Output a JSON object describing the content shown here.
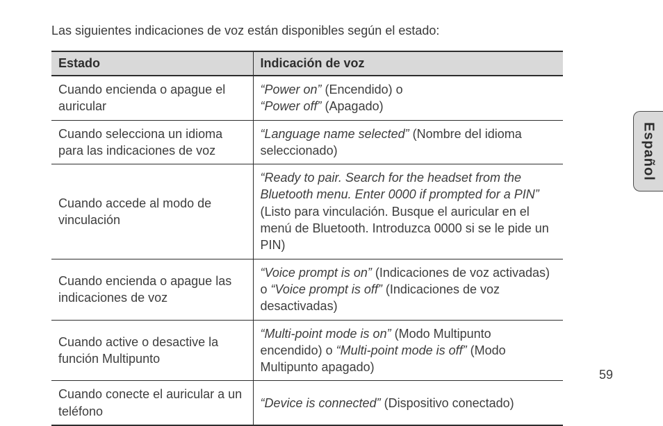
{
  "intro": "Las siguientes indicaciones de voz están disponibles según el estado:",
  "headers": {
    "status": "Estado",
    "voice": "Indicación de voz"
  },
  "rows": [
    {
      "status": "Cuando encienda o apague el auricular",
      "voice_html": "<span class=\"ital\">“Power on”</span> (Encendido) o <br><span class=\"ital\">“Power off”</span> (Apagado)"
    },
    {
      "status": "Cuando selecciona un idioma para las indicaciones de voz",
      "voice_html": "<span class=\"ital\">“Language name selected”</span> (Nombre del idioma seleccionado)"
    },
    {
      "status": "Cuando accede al modo de vinculación",
      "voice_html": "<span class=\"ital\">“Ready to pair. Search for the headset from the Bluetooth menu. Enter 0000 if prompted for a PIN”</span> (Listo para vinculación. Busque el auricular en el menú de Bluetooth. Introduzca 0000 si se le pide un PIN)"
    },
    {
      "status": "Cuando encienda o apague las indicaciones de voz",
      "voice_html": "<span class=\"ital\">“Voice prompt is on”</span> (Indicaciones de voz activadas) o <span class=\"ital\">“Voice prompt is off”</span> (Indicaciones de voz desactivadas)"
    },
    {
      "status": "Cuando active o desactive la función Multipunto",
      "voice_html": "<span class=\"ital\">“Multi-point mode is on”</span> (Modo Multipunto encendido) o <span class=\"ital\">“Multi-point mode is off”</span> (Modo Multipunto apagado)"
    },
    {
      "status": "Cuando conecte el auricular a un teléfono",
      "voice_html": "<span class=\"ital\">“Device is connected”</span> (Dispositivo conectado)"
    }
  ],
  "page_number": "59",
  "side_tab": "Español"
}
